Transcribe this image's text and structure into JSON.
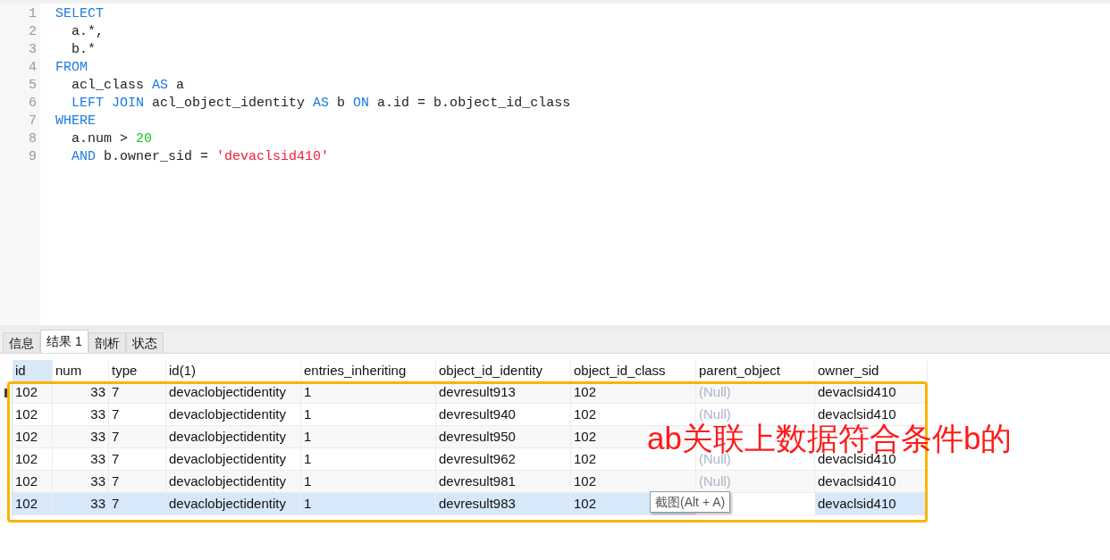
{
  "editor": {
    "lines": [
      {
        "number": "1",
        "tokens": [
          {
            "kind": "keyword",
            "text": "SELECT"
          }
        ]
      },
      {
        "number": "2",
        "tokens": [
          {
            "kind": "plain",
            "text": "  a.*,"
          }
        ]
      },
      {
        "number": "3",
        "tokens": [
          {
            "kind": "plain",
            "text": "  b.*"
          }
        ]
      },
      {
        "number": "4",
        "tokens": [
          {
            "kind": "keyword",
            "text": "FROM"
          }
        ]
      },
      {
        "number": "5",
        "tokens": [
          {
            "kind": "plain",
            "text": "  acl_class "
          },
          {
            "kind": "keyword",
            "text": "AS"
          },
          {
            "kind": "plain",
            "text": " a"
          }
        ]
      },
      {
        "number": "6",
        "tokens": [
          {
            "kind": "keyword",
            "text": "  LEFT JOIN"
          },
          {
            "kind": "plain",
            "text": " acl_object_identity "
          },
          {
            "kind": "keyword",
            "text": "AS"
          },
          {
            "kind": "plain",
            "text": " b "
          },
          {
            "kind": "keyword",
            "text": "ON"
          },
          {
            "kind": "plain",
            "text": " a.id = b.object_id_class"
          }
        ]
      },
      {
        "number": "7",
        "tokens": [
          {
            "kind": "keyword",
            "text": "WHERE"
          }
        ]
      },
      {
        "number": "8",
        "tokens": [
          {
            "kind": "plain",
            "text": "  a.num > "
          },
          {
            "kind": "number",
            "text": "20"
          }
        ]
      },
      {
        "number": "9",
        "tokens": [
          {
            "kind": "keyword",
            "text": "  AND"
          },
          {
            "kind": "plain",
            "text": " b.owner_sid = "
          },
          {
            "kind": "string",
            "text": "'devaclsid410'"
          }
        ]
      }
    ]
  },
  "tabs": [
    {
      "label": "信息",
      "selected": false
    },
    {
      "label": "结果 1",
      "selected": true
    },
    {
      "label": "剖析",
      "selected": false
    },
    {
      "label": "状态",
      "selected": false
    }
  ],
  "table": {
    "columns": [
      {
        "label": "id",
        "selected": true,
        "kind": "text"
      },
      {
        "label": "num",
        "selected": false,
        "kind": "number"
      },
      {
        "label": "type",
        "selected": false,
        "kind": "text"
      },
      {
        "label": "id(1)",
        "selected": false,
        "kind": "text"
      },
      {
        "label": "entries_inheriting",
        "selected": false,
        "kind": "text"
      },
      {
        "label": "object_id_identity",
        "selected": false,
        "kind": "text"
      },
      {
        "label": "object_id_class",
        "selected": false,
        "kind": "text"
      },
      {
        "label": "parent_object",
        "selected": false,
        "kind": "text"
      },
      {
        "label": "owner_sid",
        "selected": false,
        "kind": "text"
      }
    ],
    "rows": [
      {
        "selected": true,
        "highlighted": false,
        "cells": [
          "102",
          "33",
          "7",
          "devaclobjectidentity",
          "1",
          "devresult913",
          "102",
          {
            "text": "(Null)",
            "null": true
          },
          "devaclsid410"
        ]
      },
      {
        "selected": false,
        "highlighted": false,
        "cells": [
          "102",
          "33",
          "7",
          "devaclobjectidentity",
          "1",
          "devresult940",
          "102",
          {
            "text": "(Null)",
            "null": true
          },
          "devaclsid410"
        ]
      },
      {
        "selected": false,
        "highlighted": false,
        "cells": [
          "102",
          "33",
          "7",
          "devaclobjectidentity",
          "1",
          "devresult950",
          "102",
          null,
          null
        ]
      },
      {
        "selected": false,
        "highlighted": false,
        "cells": [
          "102",
          "33",
          "7",
          "devaclobjectidentity",
          "1",
          "devresult962",
          "102",
          {
            "text": "(Null)",
            "null": true
          },
          "devaclsid410"
        ]
      },
      {
        "selected": false,
        "highlighted": false,
        "cells": [
          "102",
          "33",
          "7",
          "devaclobjectidentity",
          "1",
          "devresult981",
          "102",
          {
            "text": "(Null)",
            "null": true
          },
          "devaclsid410"
        ]
      },
      {
        "selected": false,
        "highlighted": true,
        "cells": [
          "102",
          "33",
          "7",
          "devaclobjectidentity",
          "1",
          "devresult983",
          "102",
          null,
          "devaclsid410"
        ]
      }
    ]
  },
  "annotation": {
    "text": "ab关联上数据符合条件b的"
  },
  "tooltip": {
    "text": "截图(Alt + A)"
  }
}
